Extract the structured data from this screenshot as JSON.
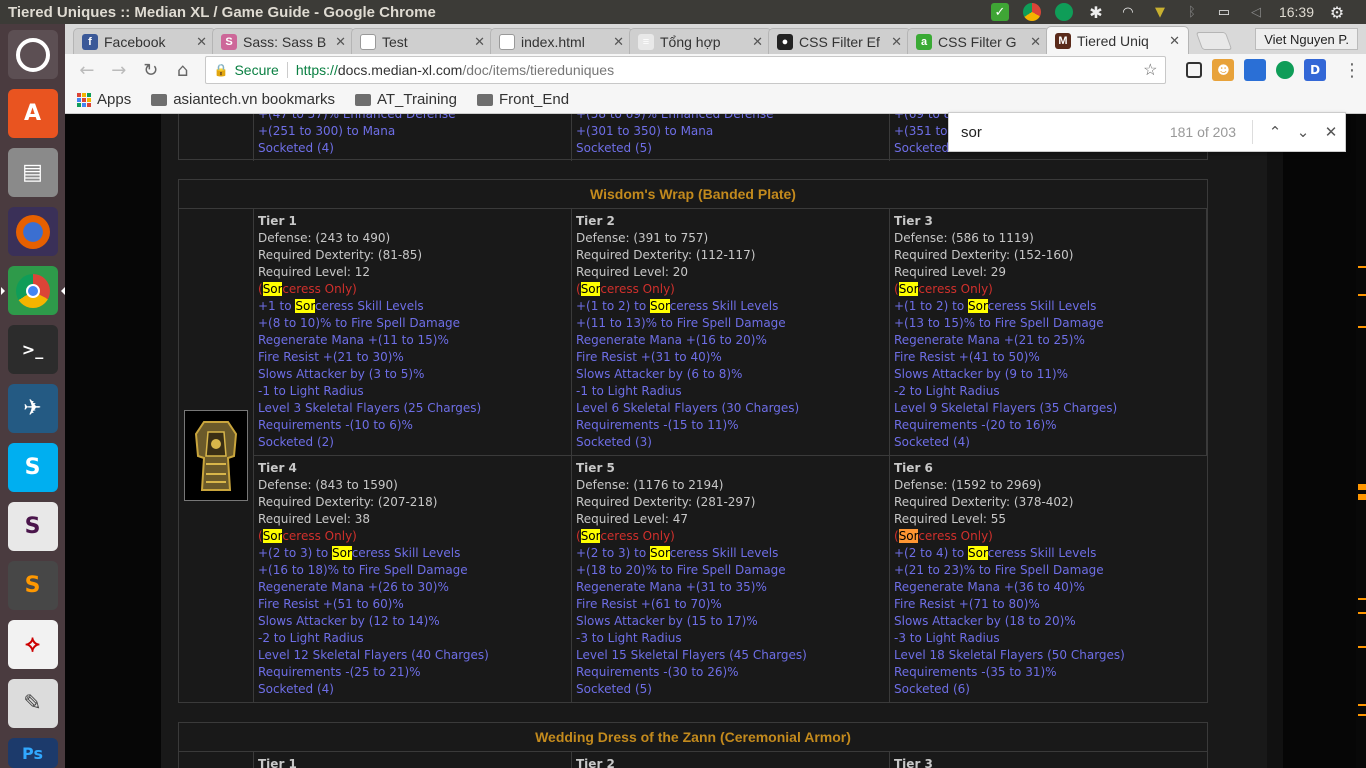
{
  "window_title": "Tiered Uniques :: Median XL / Game Guide - Google Chrome",
  "tray": {
    "clock": "16:39",
    "user": "Viet Nguyen P."
  },
  "tabs": [
    {
      "label": "Facebook",
      "icon": "facebook-icon",
      "color": "#3b5998",
      "glyph": "f"
    },
    {
      "label": "Sass: Sass B",
      "icon": "sass-icon",
      "color": "#cd6799",
      "glyph": "S"
    },
    {
      "label": "Test",
      "icon": "page-icon",
      "color": "#ffffff",
      "glyph": ""
    },
    {
      "label": "index.html",
      "icon": "page-icon",
      "color": "#ffffff",
      "glyph": ""
    },
    {
      "label": "Tổng hợp",
      "icon": "docs-icon",
      "color": "#e8e8e8",
      "glyph": "≡"
    },
    {
      "label": "CSS Filter Ef",
      "icon": "github-icon",
      "color": "#222222",
      "glyph": "●"
    },
    {
      "label": "CSS Filter G",
      "icon": "a-icon",
      "color": "#3aaa35",
      "glyph": "a"
    },
    {
      "label": "Tiered Uniq",
      "icon": "median-icon",
      "color": "#5a2a1a",
      "glyph": "M",
      "active": true
    }
  ],
  "url": {
    "secure": "Secure",
    "scheme": "https://",
    "host": "docs.median-xl.com",
    "path": "/doc/items/tiereduniques"
  },
  "bookmarks": [
    {
      "label": "Apps",
      "kind": "apps"
    },
    {
      "label": "asiantech.vn bookmarks",
      "kind": "folder"
    },
    {
      "label": "AT_Training",
      "kind": "folder"
    },
    {
      "label": "Front_End",
      "kind": "folder"
    }
  ],
  "find": {
    "query": "sor",
    "count": "181 of 203"
  },
  "prev_item": {
    "cols": [
      [
        "+(251 to 300) to Mana",
        "Socketed (4)"
      ],
      [
        "+(301 to 350) to Mana",
        "Socketed (5)"
      ],
      [
        "+(351 to 4",
        "Socketed"
      ]
    ],
    "partial": [
      "+(47 to 57)% Enhanced Defense",
      "+(58 to 69)% Enhanced Defense",
      "+(69 to 8"
    ]
  },
  "item": {
    "title": "Wisdom's Wrap (Banded Plate)",
    "tiers": [
      {
        "name": "Tier 1",
        "defense": "Defense: (243 to 490)",
        "dex": "Required Dexterity: (81-85)",
        "level": "Required Level: 12",
        "skill": "+1 to ",
        "skill_tail": "ceress Skill Levels",
        "mods": [
          "+(8 to 10)% to Fire Spell Damage",
          "Regenerate Mana +(11 to 15)%",
          "Fire Resist +(21 to 30)%",
          "Slows Attacker by (3 to 5)%",
          "-1 to Light Radius",
          "Level 3 Skeletal Flayers (25 Charges)",
          "Requirements -(10 to 6)%",
          "Socketed (2)"
        ]
      },
      {
        "name": "Tier 2",
        "defense": "Defense: (391 to 757)",
        "dex": "Required Dexterity: (112-117)",
        "level": "Required Level: 20",
        "skill": "+(1 to 2) to ",
        "skill_tail": "ceress Skill Levels",
        "mods": [
          "+(11 to 13)% to Fire Spell Damage",
          "Regenerate Mana +(16 to 20)%",
          "Fire Resist +(31 to 40)%",
          "Slows Attacker by (6 to 8)%",
          "-1 to Light Radius",
          "Level 6 Skeletal Flayers (30 Charges)",
          "Requirements -(15 to 11)%",
          "Socketed (3)"
        ]
      },
      {
        "name": "Tier 3",
        "defense": "Defense: (586 to 1119)",
        "dex": "Required Dexterity: (152-160)",
        "level": "Required Level: 29",
        "skill": "+(1 to 2) to ",
        "skill_tail": "ceress Skill Levels",
        "mods": [
          "+(13 to 15)% to Fire Spell Damage",
          "Regenerate Mana +(21 to 25)%",
          "Fire Resist +(41 to 50)%",
          "Slows Attacker by (9 to 11)%",
          "-2 to Light Radius",
          "Level 9 Skeletal Flayers (35 Charges)",
          "Requirements -(20 to 16)%",
          "Socketed (4)"
        ]
      },
      {
        "name": "Tier 4",
        "defense": "Defense: (843 to 1590)",
        "dex": "Required Dexterity: (207-218)",
        "level": "Required Level: 38",
        "skill": "+(2 to 3) to ",
        "skill_tail": "ceress Skill Levels",
        "mods": [
          "+(16 to 18)% to Fire Spell Damage",
          "Regenerate Mana +(26 to 30)%",
          "Fire Resist +(51 to 60)%",
          "Slows Attacker by (12 to 14)%",
          "-2 to Light Radius",
          "Level 12 Skeletal Flayers (40 Charges)",
          "Requirements -(25 to 21)%",
          "Socketed (4)"
        ]
      },
      {
        "name": "Tier 5",
        "defense": "Defense: (1176 to 2194)",
        "dex": "Required Dexterity: (281-297)",
        "level": "Required Level: 47",
        "skill": "+(2 to 3) to ",
        "skill_tail": "ceress Skill Levels",
        "mods": [
          "+(18 to 20)% to Fire Spell Damage",
          "Regenerate Mana +(31 to 35)%",
          "Fire Resist +(61 to 70)%",
          "Slows Attacker by (15 to 17)%",
          "-3 to Light Radius",
          "Level 15 Skeletal Flayers (45 Charges)",
          "Requirements -(30 to 26)%",
          "Socketed (5)"
        ]
      },
      {
        "name": "Tier 6",
        "defense": "Defense: (1592 to 2969)",
        "dex": "Required Dexterity: (378-402)",
        "level": "Required Level: 55",
        "skill": "+(2 to 4) to ",
        "skill_tail": "ceress Skill Levels",
        "mods": [
          "+(21 to 23)% to Fire Spell Damage",
          "Regenerate Mana +(36 to 40)%",
          "Fire Resist +(71 to 80)%",
          "Slows Attacker by (18 to 20)%",
          "-3 to Light Radius",
          "Level 18 Skeletal Flayers (50 Charges)",
          "Requirements -(35 to 31)%",
          "Socketed (6)"
        ]
      }
    ],
    "class_hl": "Sor",
    "class_tail": "ceress Only)",
    "class_prefix": "("
  },
  "next_item": {
    "title": "Wedding Dress of the Zann (Ceremonial Armor)",
    "tiers": [
      "Tier 1",
      "Tier 2",
      "Tier 3"
    ]
  },
  "colors": {
    "title_gold": "#c38a1d",
    "mod_blue": "#6e6ee6",
    "class_red": "#d0302c",
    "highlight": "#ffff00"
  }
}
